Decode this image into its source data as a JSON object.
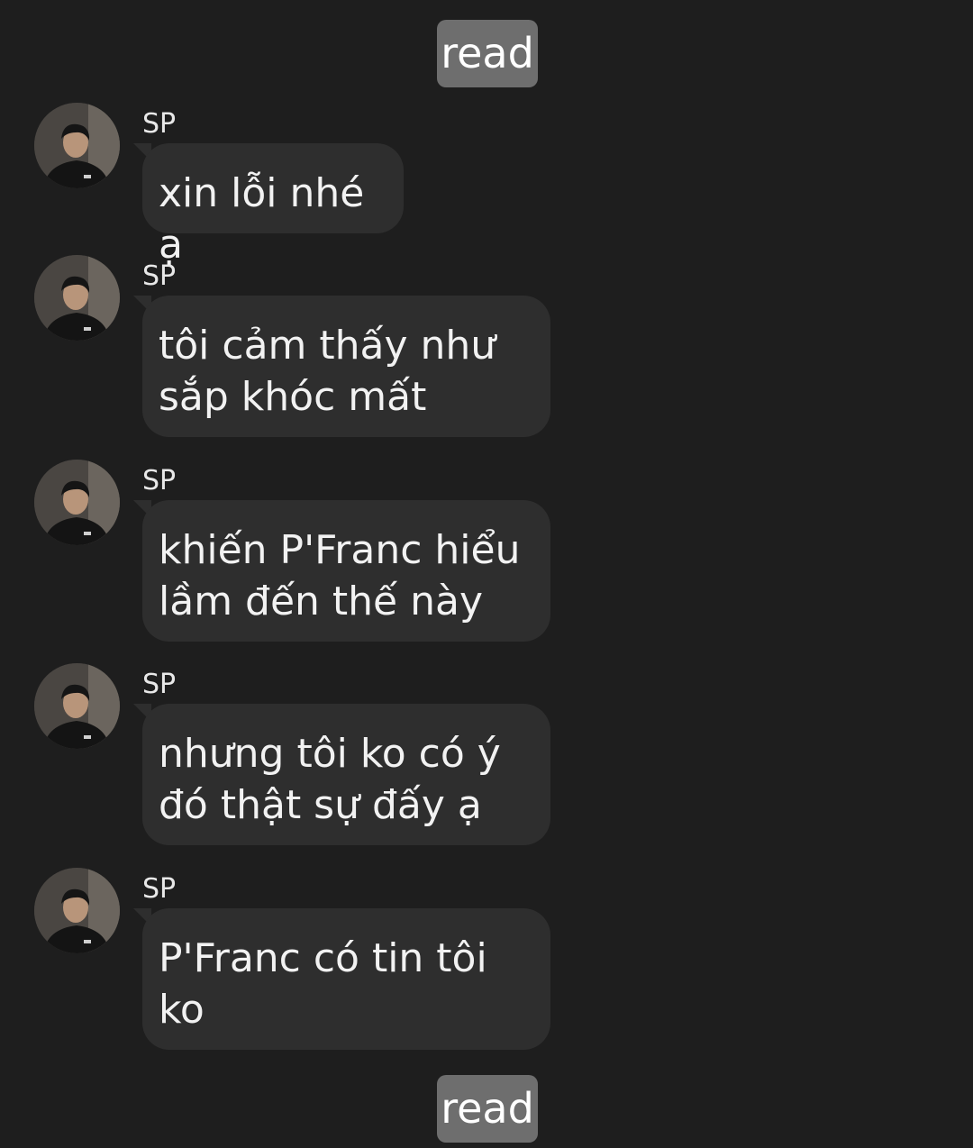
{
  "read_top": "read",
  "read_bottom": "read",
  "messages": [
    {
      "sender": "SP",
      "text": "xin lỗi nhé ạ"
    },
    {
      "sender": "SP",
      "text": "tôi cảm thấy như\nsắp khóc mất"
    },
    {
      "sender": "SP",
      "text": "khiến P'Franc hiểu\nlầm đến thế này"
    },
    {
      "sender": "SP",
      "text": "nhưng tôi ko có ý\nđó thật sự đấy ạ"
    },
    {
      "sender": "SP",
      "text": "P'Franc có tin tôi\nko"
    }
  ],
  "colors": {
    "background": "#1e1e1e",
    "bubble": "#2e2e2e",
    "read_badge": "#6e6e6e",
    "text": "#f2f2f2"
  },
  "icons": {
    "avatar": "profile-photo"
  }
}
